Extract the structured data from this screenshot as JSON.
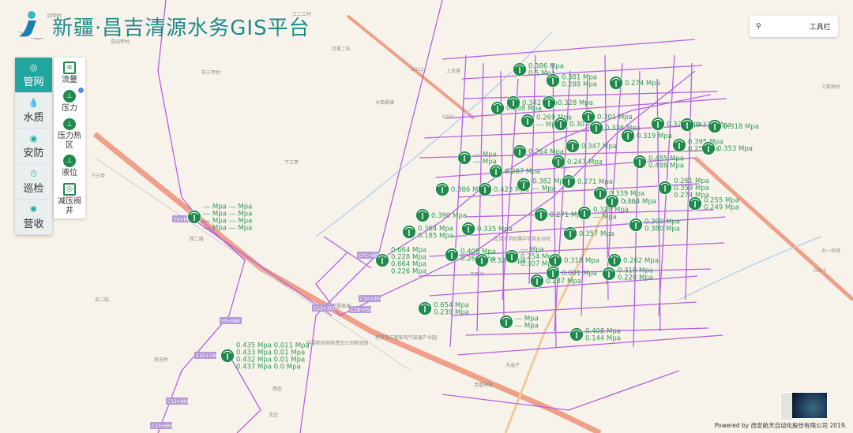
{
  "header": {
    "title": "新疆·昌吉清源水务GIS平台"
  },
  "main_menu": [
    {
      "label": "管网",
      "icon": "pipe-network-icon",
      "active": true
    },
    {
      "label": "水质",
      "icon": "water-drop-icon"
    },
    {
      "label": "安防",
      "icon": "camera-icon"
    },
    {
      "label": "巡检",
      "icon": "stopwatch-icon"
    },
    {
      "label": "营收",
      "icon": "sun-coin-icon"
    }
  ],
  "sub_menu": [
    {
      "label": "流量",
      "icon": "flow-meter-icon"
    },
    {
      "label": "压力",
      "icon": "pressure-gauge-icon",
      "checked": true
    },
    {
      "label": "压力热区",
      "icon": "pressure-heat-icon"
    },
    {
      "label": "液位",
      "icon": "water-level-icon"
    },
    {
      "label": "减压阀井",
      "icon": "pressure-valve-icon"
    }
  ],
  "toolbar": {
    "search_placeholder": "",
    "label": "工具栏"
  },
  "footer": {
    "text": "Powered by 西安航天自动化股份有限公司 2019."
  },
  "colors": {
    "brand": "#22a6a0",
    "marker": "#1f8a4c",
    "label": "#2f9a58",
    "pipe": "#b561e0",
    "highway": "#eea08a"
  },
  "pipe_tags": [
    "Y4+800",
    "CY1+800",
    "C10+050",
    "C13+300",
    "C18+050",
    "Y0+060",
    "C15+740",
    "C13+800",
    "C13+800"
  ],
  "places": [
    "四甲村",
    "东四甲村",
    "红星二队",
    "三二工村",
    "东三甲村",
    "下三甲",
    "下三甲",
    "大西渠镇",
    "北京大学附属中学昌吉分校",
    "下西沟",
    "特变电工智能电气装备产业园",
    "中疆物流有限责任公司物流园",
    "西二畦",
    "东二畦",
    "南吉村",
    "北庄",
    "西庄",
    "工程局村",
    "五一农场",
    "大庙子",
    "上东营"
  ],
  "road_labels": [
    "G312",
    "G312",
    "G312",
    "连霍高速",
    "连霍高速",
    "S201"
  ],
  "markers": [
    {
      "lines": [
        "0.386 Mpa",
        "0.5 Mpa"
      ]
    },
    {
      "lines": [
        "0.381 Mpa",
        "0.288 Mpa"
      ]
    },
    {
      "lines": [
        "0.274 Mpa"
      ]
    },
    {
      "lines": [
        "0.342 Mpa"
      ]
    },
    {
      "lines": [
        "0.268 Mpa"
      ]
    },
    {
      "lines": [
        "0.328 Mpa"
      ]
    },
    {
      "lines": [
        "0.269 Mpa",
        "--- Mpa"
      ]
    },
    {
      "lines": [
        "0.30 Mpa"
      ]
    },
    {
      "lines": [
        "0.301 Mpa"
      ]
    },
    {
      "lines": [
        "0.336 Mpa"
      ]
    },
    {
      "lines": [
        "0.329 Mpa"
      ]
    },
    {
      "lines": [
        "0.333 Mpa"
      ]
    },
    {
      "lines": [
        "0.318 Mpa"
      ]
    },
    {
      "lines": [
        "0.319 Mpa"
      ]
    },
    {
      "lines": [
        "0.347 Mpa"
      ]
    },
    {
      "lines": [
        "0.395 Mpa",
        "0.25 Mpa"
      ]
    },
    {
      "lines": [
        "0.353 Mpa"
      ]
    },
    {
      "lines": [
        "0.264 Mpa"
      ]
    },
    {
      "lines": [
        "--- Mpa",
        "--- Mpa"
      ]
    },
    {
      "lines": [
        "0.247 Mpa"
      ]
    },
    {
      "lines": [
        "0.485 Mpa",
        "0.488 Mpa"
      ]
    },
    {
      "lines": [
        "0.287 Mpa"
      ]
    },
    {
      "lines": [
        "0.386 Mpa"
      ]
    },
    {
      "lines": [
        "0.423 Mpa"
      ]
    },
    {
      "lines": [
        "0.382 Mpa",
        "--- Mpa"
      ]
    },
    {
      "lines": [
        "0.271 Mpa"
      ]
    },
    {
      "lines": [
        "0.339 Mpa"
      ]
    },
    {
      "lines": [
        "0.261 Mpa",
        "0.359 Mpa",
        "0.274 Mpa"
      ]
    },
    {
      "lines": [
        "0.364 Mpa"
      ]
    },
    {
      "lines": [
        "0.255 Mpa",
        "0.249 Mpa"
      ]
    },
    {
      "lines": [
        "0.390 Mpa"
      ]
    },
    {
      "lines": [
        "0.271 Mpa"
      ]
    },
    {
      "lines": [
        "0.328 Mpa",
        "--- Mpa"
      ]
    },
    {
      "lines": [
        "0.364 Mpa",
        "0.185 Mpa"
      ]
    },
    {
      "lines": [
        "0.335 Mpa"
      ]
    },
    {
      "lines": [
        "0.357 Mpa"
      ]
    },
    {
      "lines": [
        "0.300 Mpa",
        "0.380 Mpa"
      ]
    },
    {
      "lines": [
        "--- Mpa --- Mpa",
        "--- Mpa --- Mpa",
        "--- Mpa --- Mpa",
        "--- Mpa --- Mpa"
      ]
    },
    {
      "lines": [
        "0.664 Mpa",
        "0.228 Mpa",
        "0.664 Mpa",
        "0.226 Mpa"
      ]
    },
    {
      "lines": [
        "0.408 Mpa",
        "0.262 Mpa"
      ]
    },
    {
      "lines": [
        "0.324 Mpa"
      ]
    },
    {
      "lines": [
        "--- Mpa",
        "0.254 Mpa",
        "0.307 Mpa"
      ]
    },
    {
      "lines": [
        "0.318 Mpa"
      ]
    },
    {
      "lines": [
        "0.262 Mpa"
      ]
    },
    {
      "lines": [
        "0.001 Mpa"
      ]
    },
    {
      "lines": [
        "0.319 Mpa",
        "0.228 Mpa"
      ]
    },
    {
      "lines": [
        "0.287 Mpa"
      ]
    },
    {
      "lines": [
        "0.654 Mpa",
        "0.239 Mpa"
      ]
    },
    {
      "lines": [
        "--- Mpa",
        "--- Mpa"
      ]
    },
    {
      "lines": [
        "0.408 Mpa",
        "0.144 Mpa"
      ]
    },
    {
      "lines": [
        "0.435 Mpa 0.011 Mpa",
        "0.433 Mpa 0.01 Mpa",
        "0.432 Mpa 0.01 Mpa",
        "0.437 Mpa 0.0 Mpa"
      ]
    }
  ]
}
